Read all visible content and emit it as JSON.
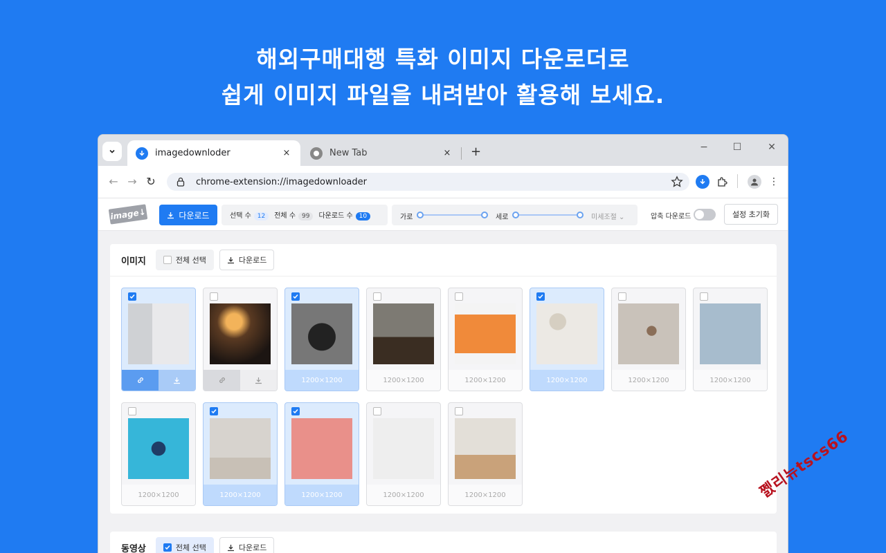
{
  "headline": {
    "line1": "해외구매대행 특화 이미지 다운로더로",
    "line2": "쉽게 이미지 파일을 내려받아 활용해 보세요."
  },
  "browser": {
    "tabs": [
      {
        "label": "imagedownloder",
        "active": true,
        "icon": "download-icon"
      },
      {
        "label": "New Tab",
        "active": false,
        "icon": "chrome-icon"
      }
    ],
    "tab_close": "×",
    "new_tab": "+",
    "window_controls": {
      "minimize": "−",
      "maximize": "☐",
      "close": "✕"
    },
    "nav": {
      "back": "←",
      "forward": "→",
      "reload": "↻"
    },
    "url": "chrome-extension://imagedownloader"
  },
  "app": {
    "logo_text": "image",
    "download_label": "다운로드",
    "counts": [
      {
        "label": "선택 수",
        "value": "12",
        "style": "blue-light"
      },
      {
        "label": "전체 수",
        "value": "99",
        "style": "gray"
      },
      {
        "label": "다운로드 수",
        "value": "10",
        "style": "blue"
      }
    ],
    "width_label": "가로",
    "height_label": "세로",
    "finetune_label": "미세조절",
    "compress_label": "압축 다운로드",
    "compress_enabled": false,
    "reset_label": "설정 초기화"
  },
  "images_section": {
    "title": "이미지",
    "select_all_label": "전체 선택",
    "select_all_checked": false,
    "download_label": "다운로드",
    "cards": [
      {
        "dims": "",
        "selected": true,
        "hover": true,
        "thumb": "toothbrush-photo"
      },
      {
        "dims": "",
        "selected": false,
        "hover": true,
        "thumb": "lounge-photo"
      },
      {
        "dims": "1200×1200",
        "selected": true,
        "thumb": "camera-rig-photo"
      },
      {
        "dims": "1200×1200",
        "selected": false,
        "thumb": "desk-photo"
      },
      {
        "dims": "1200×1200",
        "selected": false,
        "thumb": "phone-meter-photo"
      },
      {
        "dims": "1200×1200",
        "selected": true,
        "thumb": "plant-mirror-photo"
      },
      {
        "dims": "1200×1200",
        "selected": false,
        "thumb": "mirror-room-photo"
      },
      {
        "dims": "1200×1200",
        "selected": false,
        "thumb": "stool-photo"
      },
      {
        "dims": "1200×1200",
        "selected": false,
        "thumb": "electronics-photo"
      },
      {
        "dims": "1200×1200",
        "selected": true,
        "thumb": "chair-table-photo"
      },
      {
        "dims": "1200×1200",
        "selected": true,
        "thumb": "pink-shelf-photo"
      },
      {
        "dims": "1200×1200",
        "selected": false,
        "thumb": "side-table-photo"
      },
      {
        "dims": "1200×1200",
        "selected": false,
        "thumb": "living-room-photo"
      }
    ]
  },
  "video_section": {
    "title": "동영상",
    "select_all_label": "전체 선택",
    "select_all_checked": true,
    "download_label": "다운로드"
  },
  "watermark": "쩴리뉴tscs66",
  "colors": {
    "brand": "#1f7bf2",
    "selected_card": "#dcebfd"
  }
}
